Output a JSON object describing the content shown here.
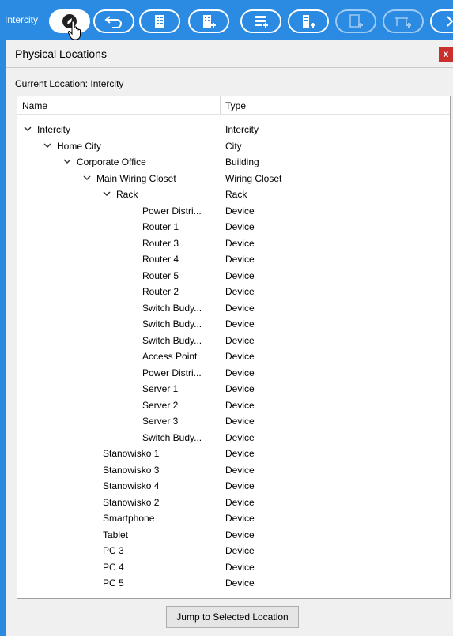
{
  "toolbar": {
    "label": "Intercity",
    "buttons": [
      {
        "name": "navigation-icon"
      },
      {
        "name": "back-icon"
      },
      {
        "name": "building-icon"
      },
      {
        "name": "new-building-icon"
      },
      {
        "name": "new-rack-icon"
      },
      {
        "name": "new-closet-icon"
      },
      {
        "name": "new-shelf-icon"
      },
      {
        "name": "new-table-icon"
      },
      {
        "name": "more-icon"
      }
    ]
  },
  "panel": {
    "title": "Physical Locations",
    "close_label": "x",
    "current_location": "Current Location: Intercity"
  },
  "tree": {
    "columns": [
      "Name",
      "Type"
    ],
    "rows": [
      {
        "name": "Intercity",
        "type": "Intercity",
        "level": 0,
        "expanded": true
      },
      {
        "name": "Home City",
        "type": "City",
        "level": 1,
        "expanded": true
      },
      {
        "name": "Corporate Office",
        "type": "Building",
        "level": 2,
        "expanded": true
      },
      {
        "name": "Main Wiring Closet",
        "type": "Wiring Closet",
        "level": 3,
        "expanded": true
      },
      {
        "name": "Rack",
        "type": "Rack",
        "level": 4,
        "expanded": true
      },
      {
        "name": "Power Distri...",
        "type": "Device",
        "level": 6
      },
      {
        "name": "Router 1",
        "type": "Device",
        "level": 6
      },
      {
        "name": "Router 3",
        "type": "Device",
        "level": 6
      },
      {
        "name": "Router 4",
        "type": "Device",
        "level": 6
      },
      {
        "name": "Router 5",
        "type": "Device",
        "level": 6
      },
      {
        "name": "Router 2",
        "type": "Device",
        "level": 6
      },
      {
        "name": "Switch Budy...",
        "type": "Device",
        "level": 6
      },
      {
        "name": "Switch Budy...",
        "type": "Device",
        "level": 6
      },
      {
        "name": "Switch Budy...",
        "type": "Device",
        "level": 6
      },
      {
        "name": "Access Point",
        "type": "Device",
        "level": 6
      },
      {
        "name": "Power Distri...",
        "type": "Device",
        "level": 6
      },
      {
        "name": "Server 1",
        "type": "Device",
        "level": 6
      },
      {
        "name": "Server 2",
        "type": "Device",
        "level": 6
      },
      {
        "name": "Server 3",
        "type": "Device",
        "level": 6
      },
      {
        "name": "Switch Budy...",
        "type": "Device",
        "level": 6
      },
      {
        "name": "Stanowisko 1",
        "type": "Device",
        "level": 4
      },
      {
        "name": "Stanowisko 3",
        "type": "Device",
        "level": 4
      },
      {
        "name": "Stanowisko 4",
        "type": "Device",
        "level": 4
      },
      {
        "name": "Stanowisko 2",
        "type": "Device",
        "level": 4
      },
      {
        "name": "Smartphone",
        "type": "Device",
        "level": 4
      },
      {
        "name": "Tablet",
        "type": "Device",
        "level": 4
      },
      {
        "name": "PC 3",
        "type": "Device",
        "level": 4
      },
      {
        "name": "PC 4",
        "type": "Device",
        "level": 4
      },
      {
        "name": "PC 5",
        "type": "Device",
        "level": 4
      }
    ]
  },
  "jump_button": "Jump to Selected Location"
}
